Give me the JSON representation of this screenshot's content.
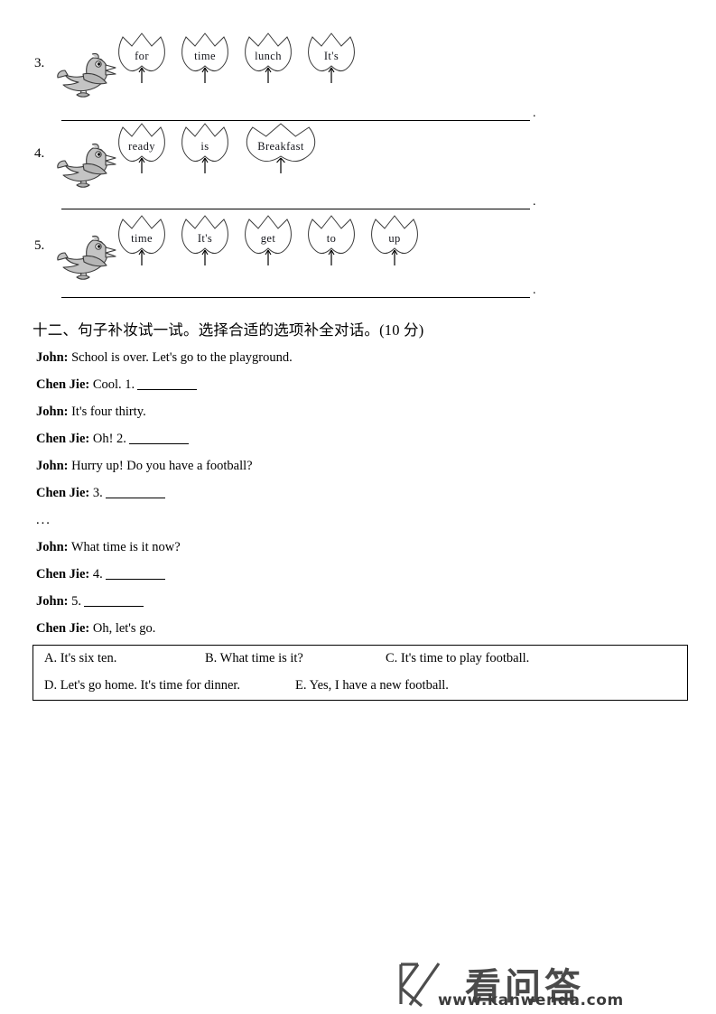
{
  "word_order_exercise": {
    "rows": [
      {
        "number": "3.",
        "icon": "singing-bird-icon",
        "leaves": [
          "for",
          "time",
          "lunch",
          "It's"
        ],
        "end_punctuation": "."
      },
      {
        "number": "4.",
        "icon": "singing-bird-icon",
        "leaves": [
          "ready",
          "is",
          "Breakfast"
        ],
        "end_punctuation": "."
      },
      {
        "number": "5.",
        "icon": "singing-bird-icon",
        "leaves": [
          "time",
          "It's",
          "get",
          "to",
          "up"
        ],
        "end_punctuation": "."
      }
    ]
  },
  "section": {
    "title": "十二、句子补妆试一试。选择合适的选项补全对话。(10 分)"
  },
  "dialogue": {
    "lines": [
      {
        "speaker": "John:",
        "text": "School is over. Let's go to the playground.",
        "blank": false
      },
      {
        "speaker": "Chen Jie:",
        "text": "Cool. 1.",
        "blank": true
      },
      {
        "speaker": "John:",
        "text": "It's four thirty.",
        "blank": false
      },
      {
        "speaker": "Chen Jie:",
        "text": "Oh! 2.",
        "blank": true
      },
      {
        "speaker": "John:",
        "text": "Hurry up! Do you have a football?",
        "blank": false
      },
      {
        "speaker": "Chen Jie:",
        "text": "3.",
        "blank": true
      },
      {
        "speaker": "",
        "text": "...",
        "blank": false,
        "ellipsis": true
      },
      {
        "speaker": "John:",
        "text": "What time is it now?",
        "blank": false
      },
      {
        "speaker": "Chen Jie:",
        "text": "4.",
        "blank": true
      },
      {
        "speaker": "John:",
        "text": "5.",
        "blank": true
      },
      {
        "speaker": "Chen Jie:",
        "text": "Oh, let's go.",
        "blank": false
      }
    ]
  },
  "options_box": {
    "row1": [
      "A. It's six ten.",
      "B. What time is it?",
      "C. It's time to play football."
    ],
    "row2": [
      "D. Let's go home. It's time for dinner.",
      "E. Yes, I have a new football."
    ]
  },
  "watermark": {
    "logo": "k-logo-icon",
    "brand": "看问答",
    "url": "www.kanwenda.com"
  }
}
